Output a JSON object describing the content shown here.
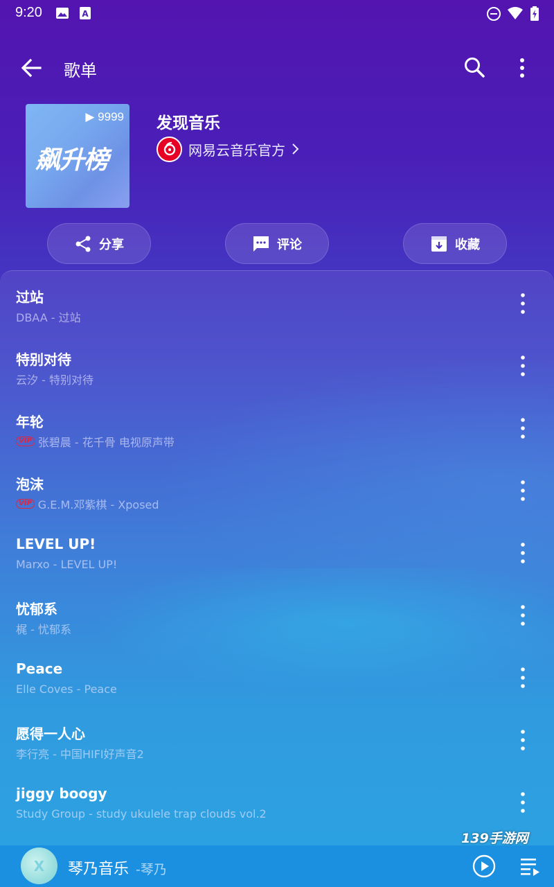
{
  "status_bar": {
    "time": "9:20",
    "icons": [
      "image-icon",
      "text-icon",
      "dnd-icon",
      "wifi-icon",
      "battery-icon"
    ]
  },
  "app_bar": {
    "title": "歌单",
    "icons": [
      "back-arrow-icon",
      "search-icon",
      "more-vert-icon"
    ]
  },
  "playlist": {
    "cover_text": "飙升榜",
    "play_count": "9999",
    "name": "发现音乐",
    "creator": "网易云音乐官方"
  },
  "actions": [
    {
      "label": "分享",
      "icon": "share-icon"
    },
    {
      "label": "评论",
      "icon": "comment-icon"
    },
    {
      "label": "收藏",
      "icon": "collect-icon"
    }
  ],
  "songs": [
    {
      "title": "过站",
      "subtitle": "DBAA - 过站",
      "vip": false
    },
    {
      "title": "特别对待",
      "subtitle": "云汐 - 特别对待",
      "vip": false
    },
    {
      "title": "年轮",
      "subtitle": "张碧晨 - 花千骨 电视原声带",
      "vip": true
    },
    {
      "title": "泡沫",
      "subtitle": "G.E.M.邓紫棋 - Xposed",
      "vip": true
    },
    {
      "title": "LEVEL UP!",
      "subtitle": "Marxo - LEVEL UP!",
      "vip": false
    },
    {
      "title": "忧郁系",
      "subtitle": "梶 - 忧郁系",
      "vip": false
    },
    {
      "title": "Peace",
      "subtitle": "Elle Coves - Peace",
      "vip": false
    },
    {
      "title": "愿得一人心",
      "subtitle": "李行亮 - 中国HIFI好声音2",
      "vip": false
    },
    {
      "title": "jiggy boogy",
      "subtitle": "Study Group - study ukulele trap clouds vol.2",
      "vip": false
    }
  ],
  "vip_label": "VIP",
  "watermark": "139手游网",
  "player": {
    "song": "琴乃音乐",
    "artist": "-琴乃",
    "avatar_letter": "X"
  },
  "colors": {
    "accent_red": "#e60026",
    "player_bar": "#1b8fe0",
    "bg_top": "#5314b0",
    "bg_bottom": "#1a9be0"
  }
}
